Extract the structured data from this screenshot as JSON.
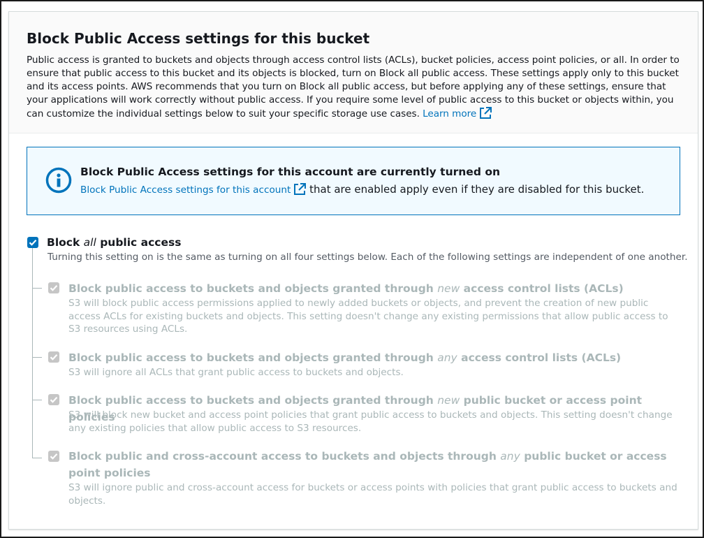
{
  "section": {
    "title": "Block Public Access settings for this bucket",
    "description": "Public access is granted to buckets and objects through access control lists (ACLs), bucket policies, access point policies, or all. In order to ensure that public access to this bucket and its objects is blocked, turn on Block all public access. These settings apply only to this bucket and its access points. AWS recommends that you turn on Block all public access, but before applying any of these settings, ensure that your applications will work correctly without public access. If you require some level of public access to this bucket or objects within, you can customize the individual settings below to suit your specific storage use cases.",
    "learn_more": "Learn more"
  },
  "info_alert": {
    "title": "Block Public Access settings for this account are currently turned on",
    "link": "Block Public Access settings for this account",
    "text": "that are enabled apply even if they are disabled for this bucket."
  },
  "block_all": {
    "label_pre": "Block ",
    "label_em": "all",
    "label_post": " public access",
    "checked": true,
    "description": "Turning this setting on is the same as turning on all four settings below. Each of the following settings are independent of one another."
  },
  "settings": [
    {
      "label_pre": "Block public access to buckets and objects granted through ",
      "label_em": "new",
      "label_post": " access control lists (ACLs)",
      "description": "S3 will block public access permissions applied to newly added buckets or objects, and prevent the creation of new public access ACLs for existing buckets and objects. This setting doesn't change any existing permissions that allow public access to S3 resources using ACLs.",
      "checked": true,
      "disabled": true
    },
    {
      "label_pre": "Block public access to buckets and objects granted through ",
      "label_em": "any",
      "label_post": " access control lists (ACLs)",
      "description": "S3 will ignore all ACLs that grant public access to buckets and objects.",
      "checked": true,
      "disabled": true
    },
    {
      "label_pre": "Block public access to buckets and objects granted through ",
      "label_em": "new",
      "label_post": " public bucket or access point policies",
      "description": "S3 will block new bucket and access point policies that grant public access to buckets and objects. This setting doesn't change any existing policies that allow public access to S3 resources.",
      "checked": true,
      "disabled": true
    },
    {
      "label_pre": "Block public and cross-account access to buckets and objects through ",
      "label_em": "any",
      "label_post": " public bucket or access point policies",
      "description": "S3 will ignore public and cross-account access for buckets or access points with policies that grant public access to buckets and objects.",
      "checked": true,
      "disabled": true
    }
  ],
  "icons": {
    "info": "info-circle-icon",
    "external": "external-link-icon",
    "check": "checkmark-icon"
  },
  "colors": {
    "link": "#0073bb",
    "info_bg": "#f1faff",
    "checkbox_on": "#0073bb",
    "disabled_text": "#aab7b8"
  }
}
